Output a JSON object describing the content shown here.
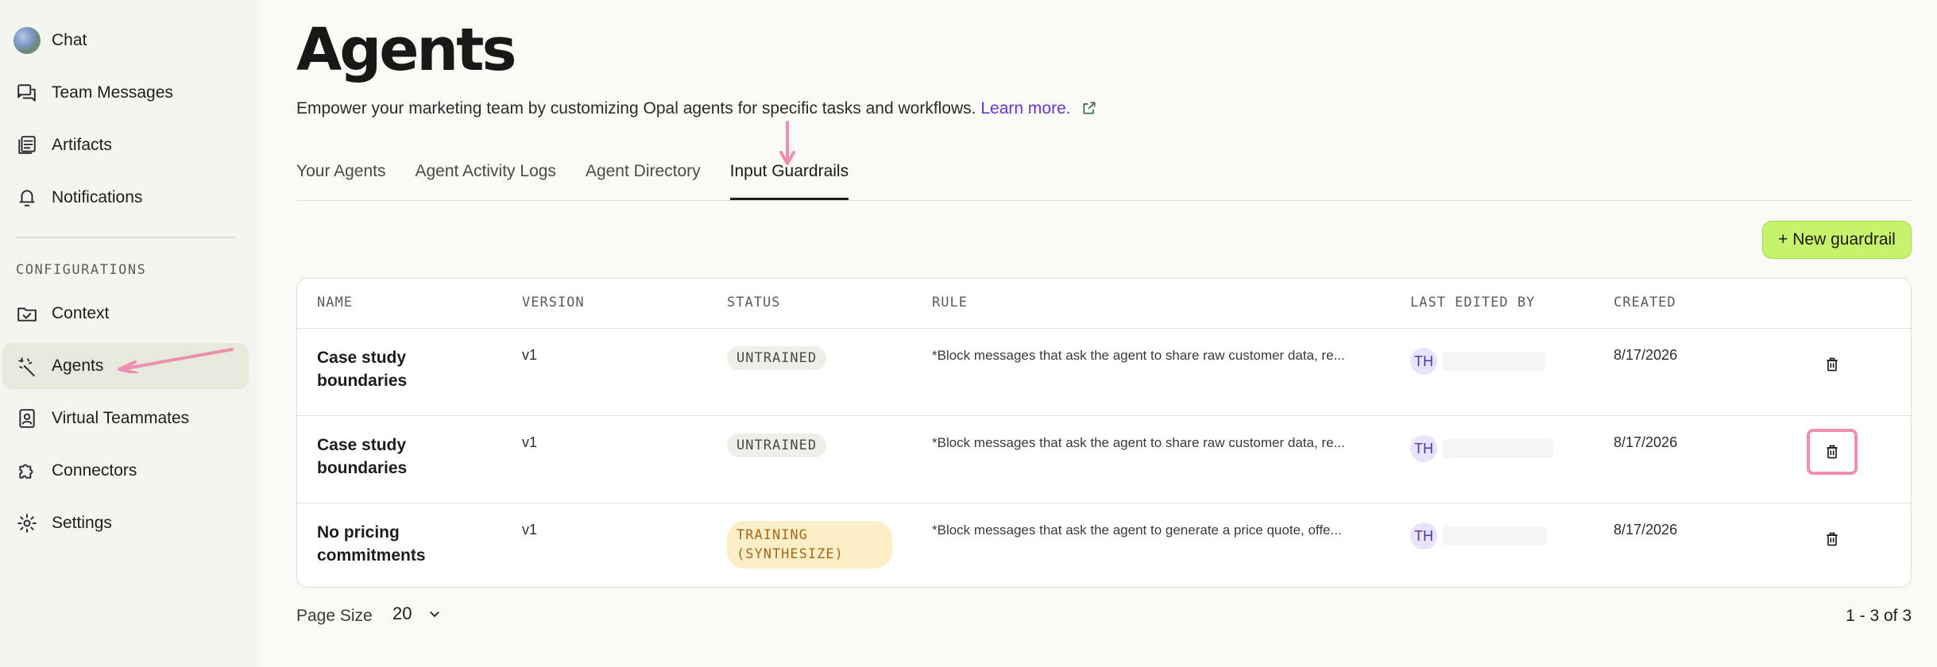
{
  "sidebar": {
    "items": [
      {
        "label": "Chat",
        "icon": "chat-avatar-icon"
      },
      {
        "label": "Team Messages",
        "icon": "messages-icon"
      },
      {
        "label": "Artifacts",
        "icon": "artifacts-icon"
      },
      {
        "label": "Notifications",
        "icon": "bell-icon"
      }
    ],
    "section_label": "CONFIGURATIONS",
    "config_items": [
      {
        "label": "Context",
        "icon": "folder-check-icon"
      },
      {
        "label": "Agents",
        "icon": "wand-icon",
        "active": true
      },
      {
        "label": "Virtual Teammates",
        "icon": "badge-person-icon"
      },
      {
        "label": "Connectors",
        "icon": "puzzle-icon"
      },
      {
        "label": "Settings",
        "icon": "gear-icon"
      }
    ]
  },
  "header": {
    "title": "Agents",
    "description": "Empower your marketing team by customizing Opal agents for specific tasks and workflows.",
    "learn_more": "Learn more."
  },
  "tabs": [
    {
      "label": "Your Agents",
      "active": false
    },
    {
      "label": "Agent Activity Logs",
      "active": false
    },
    {
      "label": "Agent Directory",
      "active": false
    },
    {
      "label": "Input Guardrails",
      "active": true
    }
  ],
  "actions": {
    "new_guardrail": "+ New guardrail"
  },
  "table": {
    "columns": [
      "NAME",
      "VERSION",
      "STATUS",
      "RULE",
      "LAST EDITED BY",
      "CREATED"
    ],
    "rows": [
      {
        "name": "Case study boundaries",
        "version": "v1",
        "status": "UNTRAINED",
        "rule": "*Block messages that ask the agent to share raw customer data, re...",
        "editor_initials": "TH",
        "created": "8/17/2026"
      },
      {
        "name": "Case study boundaries",
        "version": "v1",
        "status": "UNTRAINED",
        "rule": "*Block messages that ask the agent to share raw customer data, re...",
        "editor_initials": "TH",
        "created": "8/17/2026"
      },
      {
        "name": "No pricing commitments",
        "version": "v1",
        "status": "TRAINING (SYNTHESIZE)",
        "rule": "*Block messages that ask the agent to generate a price quote, offe...",
        "editor_initials": "TH",
        "created": "8/17/2026"
      }
    ]
  },
  "footer": {
    "page_size_label": "Page Size",
    "page_size_value": "20",
    "pagination": "1 - 3 of 3"
  },
  "colors": {
    "accent_button": "#c7f26b",
    "link": "#6b35c9",
    "annotation": "#ec8fb0",
    "active_nav": "#e7e9dc"
  }
}
